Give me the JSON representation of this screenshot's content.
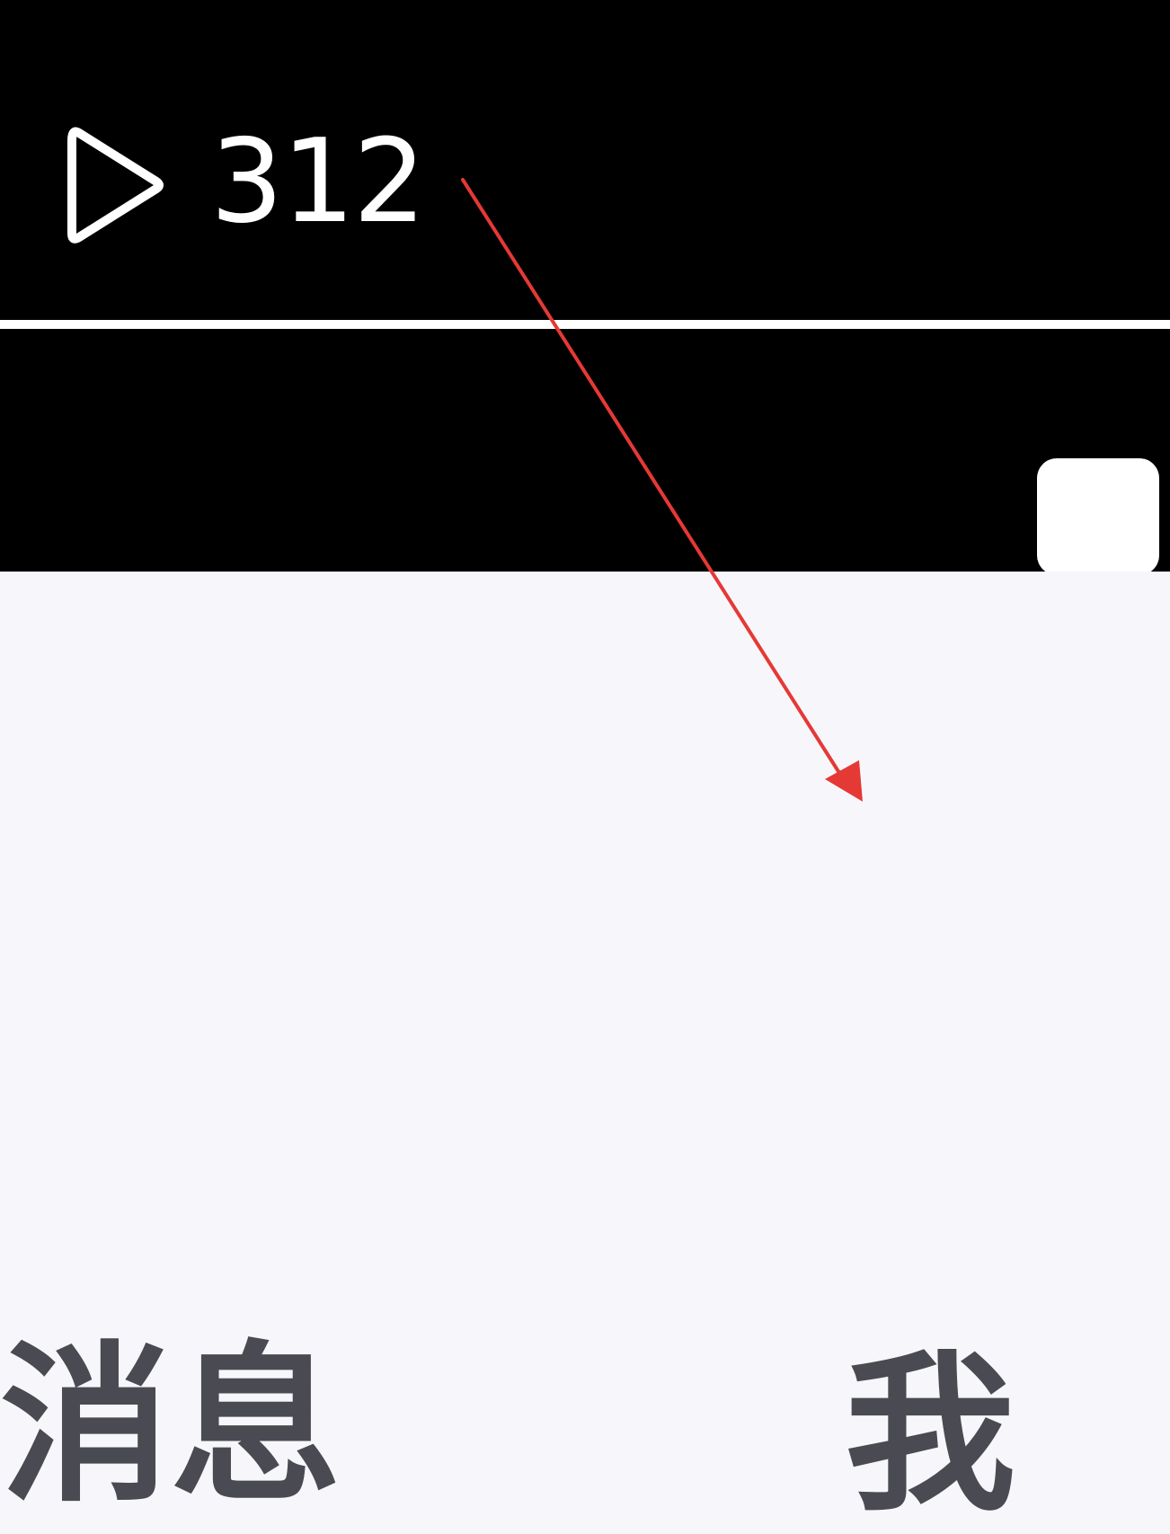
{
  "video": {
    "play_icon": "play-triangle-outline-icon",
    "play_count": "312"
  },
  "tab_bar": {
    "items": [
      {
        "label": "消息",
        "name": "messages"
      },
      {
        "label": "我",
        "name": "me"
      }
    ]
  },
  "annotation": {
    "arrow_color": "#e53935"
  }
}
